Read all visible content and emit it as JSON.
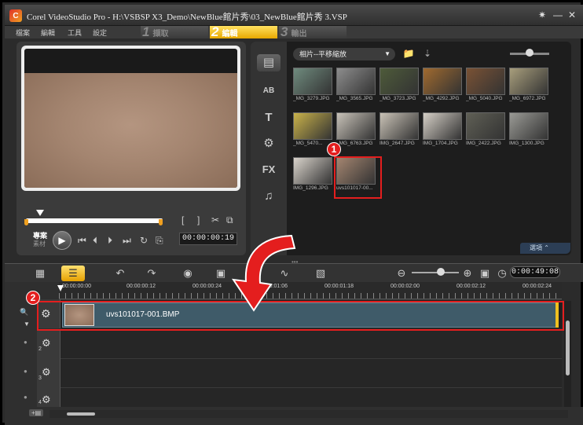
{
  "window": {
    "title": "Corel VideoStudio Pro - H:\\VSBSP X3_Demo\\NewBlue館片秀\\03_NewBlue館片秀 3.VSP",
    "logo": "C",
    "controls": [
      "✷",
      "—",
      "✕"
    ]
  },
  "menu": [
    "檔案",
    "編輯",
    "工具",
    "設定"
  ],
  "steps": [
    {
      "num": "1",
      "label": "擷取"
    },
    {
      "num": "2",
      "label": "編輯"
    },
    {
      "num": "3",
      "label": "輸出"
    }
  ],
  "player": {
    "mode_project": "專案",
    "mode_clip": "素材",
    "timecode": "00:00:00:19",
    "icons": [
      "⏮",
      "⏴",
      "⏵",
      "⏭",
      "↻",
      "⎘",
      "[",
      "]",
      "✂",
      "⧉"
    ]
  },
  "library": {
    "category": "相片--平移縮放",
    "tabs": [
      "▤",
      "AB",
      "T",
      "⚙",
      "FX",
      "♫"
    ],
    "thumbnails": [
      {
        "caption": "_MG_3279.JPG",
        "color": "#6f8b7e"
      },
      {
        "caption": "_MG_3565.JPG",
        "color": "#8d8d8d"
      },
      {
        "caption": "_MG_3723.JPG",
        "color": "#4e5b3a"
      },
      {
        "caption": "_MG_4292.JPG",
        "color": "#a06a2f"
      },
      {
        "caption": "_MG_5040.JPG",
        "color": "#7a5234"
      },
      {
        "caption": "_MG_6972.JPG",
        "color": "#a89e7c"
      },
      {
        "caption": "_MG_5470...",
        "color": "#c9b24a"
      },
      {
        "caption": "_MG_6763.JPG",
        "color": "#c8c2b8"
      },
      {
        "caption": "IMG_2647.JPG",
        "color": "#c9c2b6"
      },
      {
        "caption": "IMG_1704.JPG",
        "color": "#d5cfc6"
      },
      {
        "caption": "IMG_2422.JPG",
        "color": "#5f5f55"
      },
      {
        "caption": "IMG_1300.JPG",
        "color": "#9a9a95"
      },
      {
        "caption": "IMG_1296.JPG",
        "color": "#d9d3cb"
      },
      {
        "caption": "uvs101017-00...",
        "color": "#a48570"
      }
    ],
    "options_label": "選項 ⌃"
  },
  "timeline": {
    "timecode": "0:00:49:08",
    "toolbar_icons": [
      "▦",
      "☰",
      "↶",
      "↷",
      "◉",
      "▣",
      "∿",
      "▧"
    ],
    "ruler_labels": [
      "00:00:00:00",
      "00:00:00:12",
      "00:00:00:24",
      "00:00:01:06",
      "00:00:01:18",
      "00:00:02:00",
      "00:00:02:12",
      "00:00:02:24"
    ],
    "clip_name": "uvs101017-001.BMP",
    "track_nums": [
      "2",
      "3",
      "4"
    ]
  },
  "annotations": {
    "badge1": "1",
    "badge2": "2"
  }
}
